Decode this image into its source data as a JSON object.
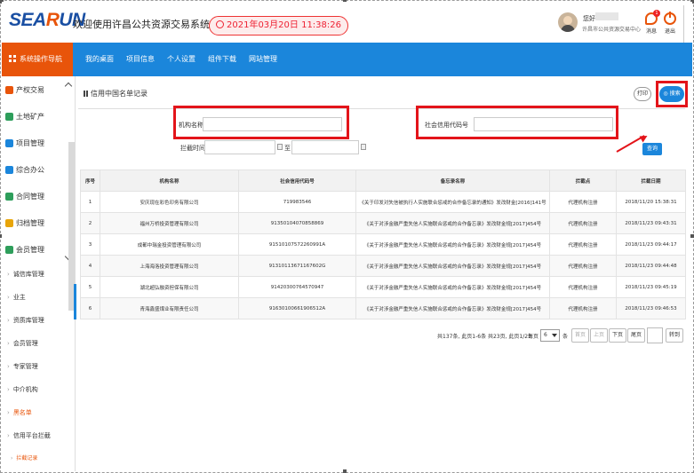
{
  "header": {
    "logo_a": "SEA",
    "logo_b": "R",
    "logo_c": "UN",
    "site_title": "欢迎使用许昌公共资源交易系统",
    "datetime": "2021年03月20日 11:38:26",
    "greeting": "您好",
    "user_org": "许昌市公共资源交易中心",
    "message_label": "消息",
    "message_count": "1",
    "logout_label": "退出"
  },
  "nav": {
    "home_label": "系统操作导航",
    "tabs": [
      "我的桌面",
      "项目信息",
      "个人设置",
      "组件下载",
      "网站管理"
    ]
  },
  "sidebar": {
    "items": [
      {
        "label": "产权交易",
        "color": "#e8540a"
      },
      {
        "label": "土地矿产",
        "color": "#2e9e5b"
      },
      {
        "label": "项目管理",
        "color": "#1b86db"
      },
      {
        "label": "综合办公",
        "color": "#1b86db"
      },
      {
        "label": "合同管理",
        "color": "#2e9e5b"
      },
      {
        "label": "归档管理",
        "color": "#e8a50a"
      },
      {
        "label": "会员管理",
        "color": "#2e9e5b"
      }
    ],
    "sub_items": [
      "诚信库管理",
      "业主",
      "资质库管理",
      "会员管理",
      "专家管理",
      "中介机构",
      "黑名单",
      "信用平台拦截",
      "拦截记录"
    ]
  },
  "content": {
    "breadcrumb": "信用中国名单记录",
    "print_label": "打印",
    "search_label": "搜索",
    "filters": {
      "org_name_label": "机构名称",
      "credit_code_label": "社会信用代码号",
      "intercept_time_label": "拦截时间",
      "to_label": "至",
      "query_label": "查询"
    },
    "table": {
      "columns": [
        "序号",
        "机构名称",
        "社会信用代码号",
        "备忘录名称",
        "拦截点",
        "拦截日期"
      ],
      "rows": [
        [
          "1",
          "安庆现在彩色印务有限公司",
          "719983546",
          "《关于印发对失信被执行人实施联合惩戒的合作备忘录的通知》发改财金[2016]141号",
          "代理机构注册",
          "2018/11/20 15:38:31"
        ],
        [
          "2",
          "福州万桥投资管理有限公司",
          "91350104070858869",
          "《关于对涉金融严重失信人实施联合惩戒的合作备忘录》发改财金规[2017]454号",
          "代理机构注册",
          "2018/11/23 09:43:31"
        ],
        [
          "3",
          "成都中瑞金投资管理有限公司",
          "91510107572260991A",
          "《关于对涉金融严重失信人实施联合惩戒的合作备忘录》发改财金规[2017]454号",
          "代理机构注册",
          "2018/11/23 09:44:17"
        ],
        [
          "4",
          "上海海洛投资管理有限公司",
          "91310113671167602G",
          "《关于对涉金融严重失信人实施联合惩戒的合作备忘录》发改财金规[2017]454号",
          "代理机构注册",
          "2018/11/23 09:44:48"
        ],
        [
          "5",
          "湖北超弘融资担保有限公司",
          "91420300764570947",
          "《关于对涉金融严重失信人实施联合惩戒的合作备忘录》发改财金规[2017]454号",
          "代理机构注册",
          "2018/11/23 09:45:19"
        ],
        [
          "6",
          "青海鑫盛煤业有限责任公司",
          "91630100661906512A",
          "《关于对涉金融严重失信人实施联合惩戒的合作备忘录》发改财金规[2017]454号",
          "代理机构注册",
          "2018/11/23 09:46:53"
        ]
      ]
    },
    "pager": {
      "info": "共137条, 此页1-6条 共23页, 此页1/23",
      "per_page_label": "每页",
      "per_page_value": "6",
      "tiao": "条",
      "first": "首页",
      "prev": "上页",
      "next": "下页",
      "last": "尾页",
      "go": "转到"
    }
  }
}
